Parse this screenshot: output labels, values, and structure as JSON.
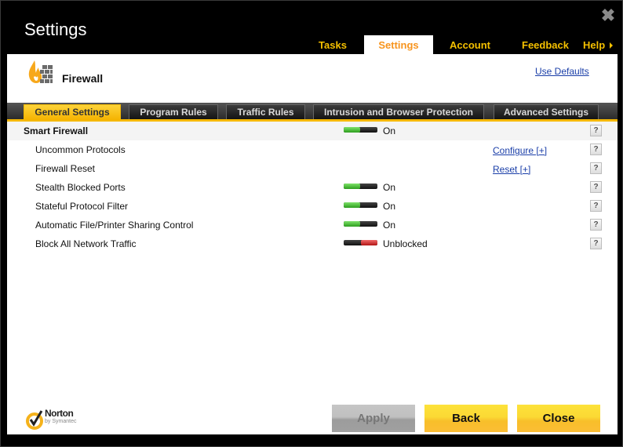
{
  "window": {
    "title": "Settings",
    "close_icon": "close-x-icon"
  },
  "nav": {
    "items": [
      {
        "label": "Tasks",
        "active": false
      },
      {
        "label": "Settings",
        "active": true
      },
      {
        "label": "Account",
        "active": false
      },
      {
        "label": "Feedback",
        "active": false
      },
      {
        "label": "Help",
        "active": false
      }
    ]
  },
  "header": {
    "icon": "firewall-icon",
    "title": "Firewall",
    "use_defaults_label": "Use Defaults"
  },
  "tabs": [
    {
      "label": "General Settings",
      "active": true
    },
    {
      "label": "Program Rules",
      "active": false
    },
    {
      "label": "Traffic Rules",
      "active": false
    },
    {
      "label": "Intrusion and Browser Protection",
      "active": false
    },
    {
      "label": "Advanced Settings",
      "active": false
    }
  ],
  "settings": [
    {
      "label": "Smart Firewall",
      "type": "header",
      "toggle": "on",
      "status": "On",
      "help": "?"
    },
    {
      "label": "Uncommon Protocols",
      "type": "sub",
      "link": "Configure [+]",
      "help": "?"
    },
    {
      "label": "Firewall Reset",
      "type": "sub",
      "link": "Reset [+]",
      "help": "?"
    },
    {
      "label": "Stealth Blocked Ports",
      "type": "sub",
      "toggle": "on",
      "status": "On",
      "help": "?"
    },
    {
      "label": "Stateful Protocol Filter",
      "type": "sub",
      "toggle": "on",
      "status": "On",
      "help": "?"
    },
    {
      "label": "Automatic File/Printer Sharing Control",
      "type": "sub",
      "toggle": "on",
      "status": "On",
      "help": "?"
    },
    {
      "label": "Block All Network Traffic",
      "type": "sub",
      "toggle": "off",
      "status": "Unblocked",
      "help": "?"
    }
  ],
  "footer": {
    "logo_name": "Norton",
    "logo_sub": "by Symantec",
    "apply_label": "Apply",
    "back_label": "Back",
    "close_label": "Close"
  },
  "colors": {
    "accent_yellow": "#f5c000",
    "active_nav_text": "#f7941d",
    "link_blue": "#1a3ea8",
    "toggle_on": "#3cb82a",
    "toggle_off": "#d42424"
  }
}
